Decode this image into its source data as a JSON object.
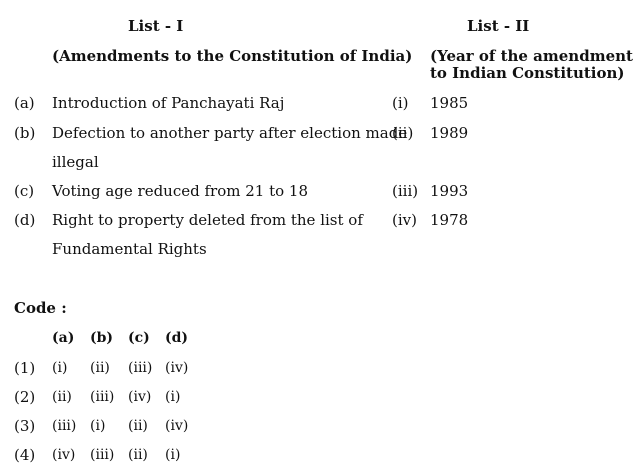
{
  "list1": {
    "title": "List - I",
    "subtitle": "(Amendments to the Constitution of India)",
    "items": [
      {
        "label": "(a)",
        "line1": "Introduction of Panchayati Raj",
        "line2": ""
      },
      {
        "label": "(b)",
        "line1": "Defection to another party after election made",
        "line2": "illegal"
      },
      {
        "label": "(c)",
        "line1": "Voting age reduced from 21 to 18",
        "line2": ""
      },
      {
        "label": "(d)",
        "line1": "Right to property deleted from the list of",
        "line2": "Fundamental Rights"
      }
    ]
  },
  "list2": {
    "title": "List - II",
    "subtitle": "(Year of the amendment to Indian Constitution)",
    "items": [
      {
        "label": "(i)",
        "value": "1985"
      },
      {
        "label": "(ii)",
        "value": "1989"
      },
      {
        "label": "(iii)",
        "value": "1993"
      },
      {
        "label": "(iv)",
        "value": "1978"
      }
    ]
  },
  "code": {
    "title": "Code :",
    "headers": [
      "(a)",
      "(b)",
      "(c)",
      "(d)"
    ],
    "options": [
      {
        "label": "(1)",
        "values": [
          "(i)",
          "(ii)",
          "(iii)",
          "(iv)"
        ]
      },
      {
        "label": "(2)",
        "values": [
          "(ii)",
          "(iii)",
          "(iv)",
          "(i)"
        ]
      },
      {
        "label": "(3)",
        "values": [
          "(iii)",
          "(i)",
          "(ii)",
          "(iv)"
        ]
      },
      {
        "label": "(4)",
        "values": [
          "(iv)",
          "(iii)",
          "(ii)",
          "(i)"
        ]
      }
    ]
  }
}
